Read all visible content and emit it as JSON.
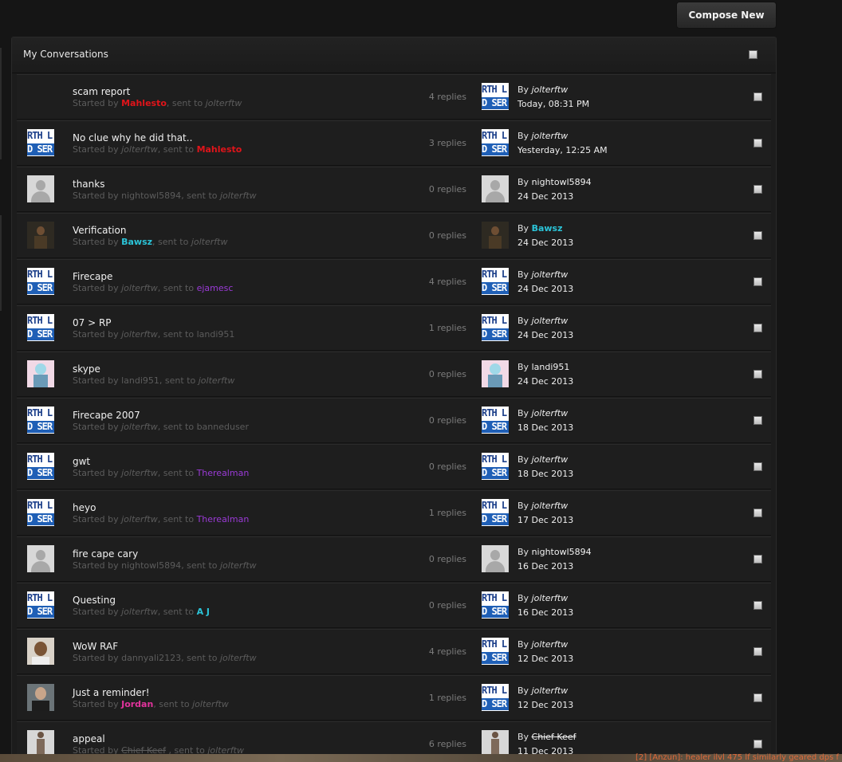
{
  "toolbar": {
    "compose_label": "Compose New"
  },
  "panel": {
    "title": "My Conversations"
  },
  "conversations": [
    {
      "title": "scam report",
      "started_prefix": "Started by ",
      "starter": "Mahlesto",
      "starter_style": "red",
      "sent_prefix": ", sent to ",
      "recipient": "jolterftw",
      "recipient_style": "italic",
      "replies": "4 replies",
      "last_by_prefix": "By ",
      "last_by": "jolterftw",
      "last_by_style": "italic",
      "last_date": "Today, 08:31 PM",
      "starter_avatar": "character",
      "last_avatar": "logo"
    },
    {
      "title": "No clue why he did that..",
      "started_prefix": "Started by ",
      "starter": "jolterftw",
      "starter_style": "italic",
      "sent_prefix": ", sent to ",
      "recipient": "Mahlesto",
      "recipient_style": "red",
      "replies": "3 replies",
      "last_by_prefix": "By ",
      "last_by": "jolterftw",
      "last_by_style": "italic",
      "last_date": "Yesterday, 12:25 AM",
      "starter_avatar": "logo",
      "last_avatar": "logo"
    },
    {
      "title": "thanks",
      "started_prefix": "Started by ",
      "starter": "nightowl5894",
      "starter_style": "plain",
      "sent_prefix": ", sent to ",
      "recipient": "jolterftw",
      "recipient_style": "italic",
      "replies": "0 replies",
      "last_by_prefix": "By ",
      "last_by": "nightowl5894",
      "last_by_style": "plain",
      "last_date": "24 Dec 2013",
      "starter_avatar": "default",
      "last_avatar": "default"
    },
    {
      "title": "Verification",
      "started_prefix": "Started by ",
      "starter": "Bawsz",
      "starter_style": "cyan",
      "sent_prefix": ", sent to ",
      "recipient": "jolterftw",
      "recipient_style": "italic",
      "replies": "0 replies",
      "last_by_prefix": "By ",
      "last_by": "Bawsz",
      "last_by_style": "cyan",
      "last_date": "24 Dec 2013",
      "starter_avatar": "dark",
      "last_avatar": "dark"
    },
    {
      "title": "Firecape",
      "started_prefix": "Started by ",
      "starter": "jolterftw",
      "starter_style": "italic",
      "sent_prefix": ", sent to ",
      "recipient": "ejamesc",
      "recipient_style": "purple",
      "replies": "4 replies",
      "last_by_prefix": "By ",
      "last_by": "jolterftw",
      "last_by_style": "italic",
      "last_date": "24 Dec 2013",
      "starter_avatar": "logo",
      "last_avatar": "logo"
    },
    {
      "title": "07 > RP",
      "started_prefix": "Started by ",
      "starter": "jolterftw",
      "starter_style": "italic",
      "sent_prefix": ", sent to ",
      "recipient": "landi951",
      "recipient_style": "plain",
      "replies": "1 replies",
      "last_by_prefix": "By ",
      "last_by": "jolterftw",
      "last_by_style": "italic",
      "last_date": "24 Dec 2013",
      "starter_avatar": "logo",
      "last_avatar": "logo"
    },
    {
      "title": "skype",
      "started_prefix": "Started by ",
      "starter": "landi951",
      "starter_style": "plain",
      "sent_prefix": ", sent to ",
      "recipient": "jolterftw",
      "recipient_style": "italic",
      "replies": "0 replies",
      "last_by_prefix": "By ",
      "last_by": "landi951",
      "last_by_style": "plain",
      "last_date": "24 Dec 2013",
      "starter_avatar": "anime",
      "last_avatar": "anime"
    },
    {
      "title": "Firecape 2007",
      "started_prefix": "Started by ",
      "starter": "jolterftw",
      "starter_style": "italic",
      "sent_prefix": ", sent to ",
      "recipient": "banneduser",
      "recipient_style": "plain",
      "replies": "0 replies",
      "last_by_prefix": "By ",
      "last_by": "jolterftw",
      "last_by_style": "italic",
      "last_date": "18 Dec 2013",
      "starter_avatar": "logo",
      "last_avatar": "logo"
    },
    {
      "title": "gwt",
      "started_prefix": "Started by ",
      "starter": "jolterftw",
      "starter_style": "italic",
      "sent_prefix": ", sent to ",
      "recipient": "Therealman",
      "recipient_style": "purple",
      "replies": "0 replies",
      "last_by_prefix": "By ",
      "last_by": "jolterftw",
      "last_by_style": "italic",
      "last_date": "18 Dec 2013",
      "starter_avatar": "logo",
      "last_avatar": "logo"
    },
    {
      "title": "heyo",
      "started_prefix": "Started by ",
      "starter": "jolterftw",
      "starter_style": "italic",
      "sent_prefix": ", sent to ",
      "recipient": "Therealman",
      "recipient_style": "purple",
      "replies": "1 replies",
      "last_by_prefix": "By ",
      "last_by": "jolterftw",
      "last_by_style": "italic",
      "last_date": "17 Dec 2013",
      "starter_avatar": "logo",
      "last_avatar": "logo"
    },
    {
      "title": "fire cape cary",
      "started_prefix": "Started by ",
      "starter": "nightowl5894",
      "starter_style": "plain",
      "sent_prefix": ", sent to ",
      "recipient": "jolterftw",
      "recipient_style": "italic",
      "replies": "0 replies",
      "last_by_prefix": "By ",
      "last_by": "nightowl5894",
      "last_by_style": "plain",
      "last_date": "16 Dec 2013",
      "starter_avatar": "default",
      "last_avatar": "default"
    },
    {
      "title": "Questing",
      "started_prefix": "Started by ",
      "starter": "jolterftw",
      "starter_style": "italic",
      "sent_prefix": ", sent to ",
      "recipient": "A J",
      "recipient_style": "cyan",
      "replies": "0 replies",
      "last_by_prefix": "By ",
      "last_by": "jolterftw",
      "last_by_style": "italic",
      "last_date": "16 Dec 2013",
      "starter_avatar": "logo",
      "last_avatar": "logo"
    },
    {
      "title": "WoW RAF",
      "started_prefix": "Started by ",
      "starter": "dannyali2123",
      "starter_style": "plain",
      "sent_prefix": ", sent to ",
      "recipient": "jolterftw",
      "recipient_style": "italic",
      "replies": "4 replies",
      "last_by_prefix": "By ",
      "last_by": "jolterftw",
      "last_by_style": "italic",
      "last_date": "12 Dec 2013",
      "starter_avatar": "face",
      "last_avatar": "logo"
    },
    {
      "title": "Just a reminder!",
      "started_prefix": "Started by ",
      "starter": "Jordan",
      "starter_style": "pink",
      "sent_prefix": ", sent to ",
      "recipient": "jolterftw",
      "recipient_style": "italic",
      "replies": "1 replies",
      "last_by_prefix": "By ",
      "last_by": "jolterftw",
      "last_by_style": "italic",
      "last_date": "12 Dec 2013",
      "starter_avatar": "suit",
      "last_avatar": "logo"
    },
    {
      "title": "appeal",
      "started_prefix": "Started by ",
      "starter": "Chief Keef",
      "starter_style": "strike",
      "sent_prefix": " , sent to ",
      "recipient": "jolterftw",
      "recipient_style": "italic",
      "replies": "6 replies",
      "last_by_prefix": "By ",
      "last_by": "Chief Keef",
      "last_by_style": "strike",
      "last_date": "11 Dec 2013",
      "starter_avatar": "figure",
      "last_avatar": "figure"
    }
  ],
  "logo_avatar": {
    "line1": "RTH L",
    "line2": "D SER"
  },
  "taskbar": {
    "chat_snippet": "[2] [Anzun]: healer ilvl 475 lf similarly geared dps f"
  }
}
